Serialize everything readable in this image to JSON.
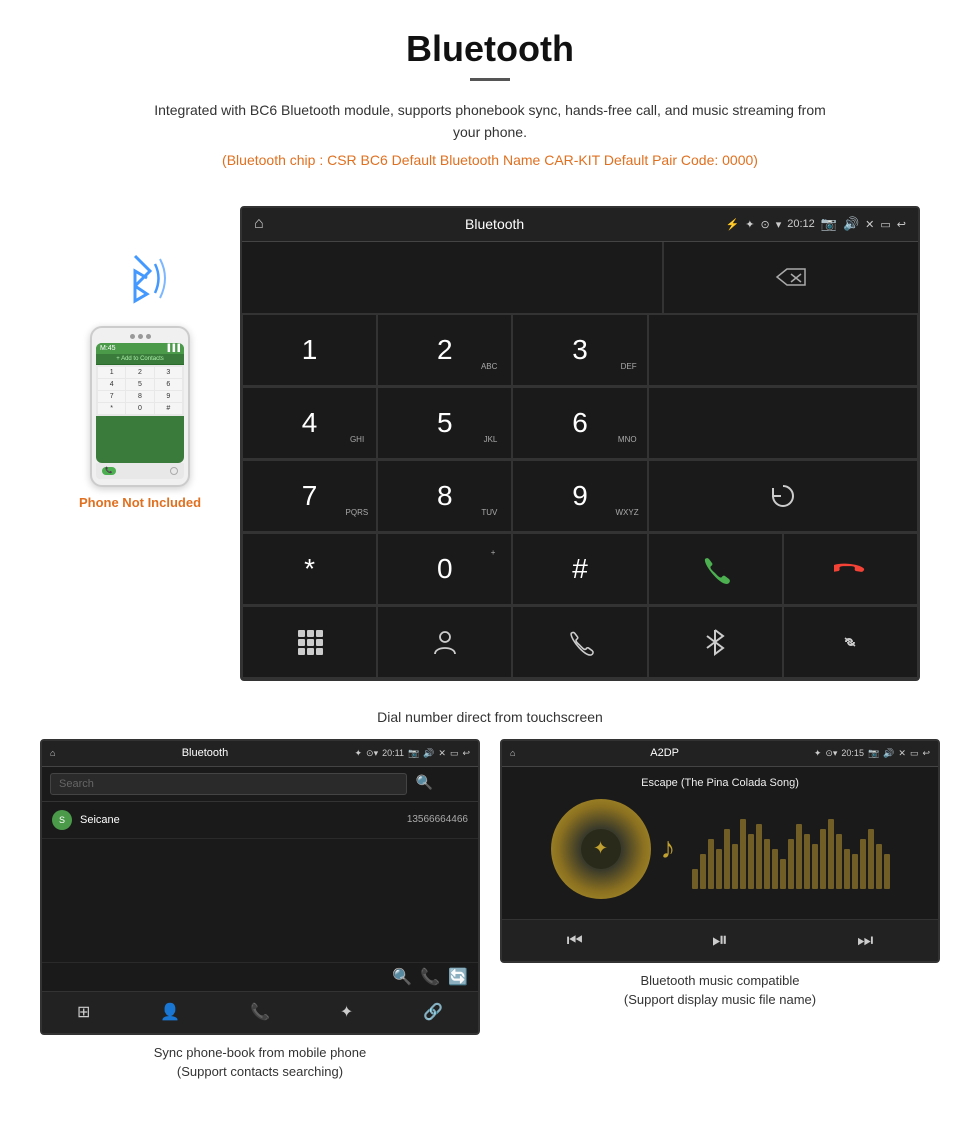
{
  "header": {
    "title": "Bluetooth",
    "description": "Integrated with BC6 Bluetooth module, supports phonebook sync, hands-free call, and music streaming from your phone.",
    "specs": "(Bluetooth chip : CSR BC6    Default Bluetooth Name CAR-KIT    Default Pair Code: 0000)"
  },
  "phone_label": "Phone Not Included",
  "dialpad_caption": "Dial number direct from touchscreen",
  "dial_screen": {
    "title": "Bluetooth",
    "time": "20:12",
    "keys": [
      {
        "num": "1",
        "sub": ""
      },
      {
        "num": "2",
        "sub": "ABC"
      },
      {
        "num": "3",
        "sub": "DEF"
      },
      {
        "num": "4",
        "sub": "GHI"
      },
      {
        "num": "5",
        "sub": "JKL"
      },
      {
        "num": "6",
        "sub": "MNO"
      },
      {
        "num": "7",
        "sub": "PQRS"
      },
      {
        "num": "8",
        "sub": "TUV"
      },
      {
        "num": "9",
        "sub": "WXYZ"
      },
      {
        "num": "*",
        "sub": ""
      },
      {
        "num": "0",
        "sub": "+"
      },
      {
        "num": "#",
        "sub": ""
      }
    ]
  },
  "phonebook_screen": {
    "title": "Bluetooth",
    "time": "20:11",
    "search_placeholder": "Search",
    "contact_name": "Seicane",
    "contact_letter": "S",
    "contact_number": "13566664466"
  },
  "music_screen": {
    "title": "A2DP",
    "time": "20:15",
    "song_title": "Escape (The Pina Colada Song)"
  },
  "bottom_left_caption_line1": "Sync phone-book from mobile phone",
  "bottom_left_caption_line2": "(Support contacts searching)",
  "bottom_right_caption_line1": "Bluetooth music compatible",
  "bottom_right_caption_line2": "(Support display music file name)",
  "eq_bars": [
    20,
    35,
    50,
    40,
    60,
    45,
    70,
    55,
    65,
    50,
    40,
    30,
    50,
    65,
    55,
    45,
    60,
    70,
    55,
    40,
    35,
    50,
    60,
    45,
    35
  ]
}
